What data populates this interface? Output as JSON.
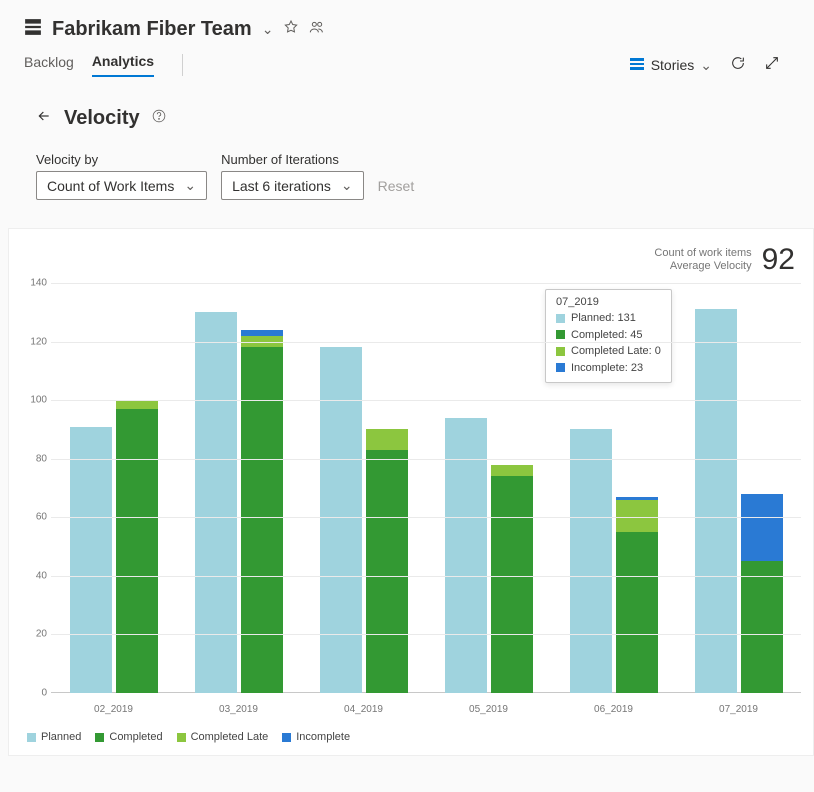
{
  "header": {
    "team_name": "Fabrikam Fiber Team"
  },
  "tabs": {
    "backlog": "Backlog",
    "analytics": "Analytics"
  },
  "tools": {
    "stories": "Stories"
  },
  "page": {
    "title": "Velocity"
  },
  "controls": {
    "velocity_by_label": "Velocity by",
    "velocity_by_value": "Count of Work Items",
    "iterations_label": "Number of Iterations",
    "iterations_value": "Last 6 iterations",
    "reset": "Reset"
  },
  "metric": {
    "line1": "Count of work items",
    "line2": "Average Velocity",
    "value": "92"
  },
  "legend_labels": {
    "planned": "Planned",
    "completed": "Completed",
    "late": "Completed Late",
    "incomplete": "Incomplete"
  },
  "tooltip": {
    "title": "07_2019",
    "planned": "Planned: 131",
    "completed": "Completed: 45",
    "late": "Completed Late: 0",
    "incomplete": "Incomplete: 23"
  },
  "chart_data": {
    "type": "bar",
    "title": "Velocity",
    "ylabel": "Count of work items",
    "ylim": [
      0,
      140
    ],
    "y_ticks": [
      0,
      20,
      40,
      60,
      80,
      100,
      120,
      140
    ],
    "categories": [
      "02_2019",
      "03_2019",
      "04_2019",
      "05_2019",
      "06_2019",
      "07_2019"
    ],
    "series": [
      {
        "name": "Planned",
        "color": "#9fd3de",
        "values": [
          91,
          130,
          118,
          94,
          90,
          131
        ]
      },
      {
        "name": "Completed",
        "color": "#339933",
        "values": [
          97,
          118,
          83,
          74,
          55,
          45
        ]
      },
      {
        "name": "Completed Late",
        "color": "#8cc63f",
        "values": [
          3,
          4,
          7,
          4,
          11,
          0
        ]
      },
      {
        "name": "Incomplete",
        "color": "#2a7ad4",
        "values": [
          0,
          2,
          0,
          0,
          1,
          23
        ]
      }
    ]
  }
}
